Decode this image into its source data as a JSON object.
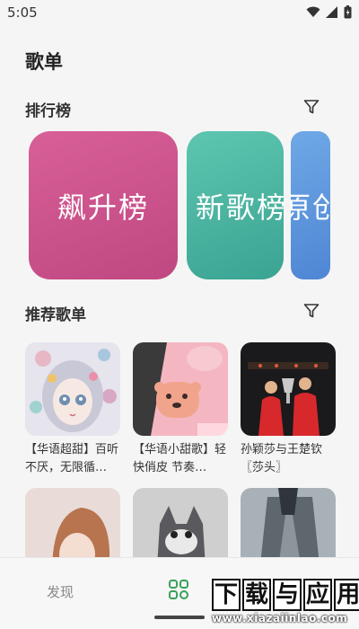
{
  "status_bar": {
    "time": "5:05"
  },
  "page": {
    "title": "歌单"
  },
  "ranking": {
    "title": "排行榜",
    "cards": [
      {
        "label": "飙升榜",
        "color_from": "#d85f98",
        "color_to": "#c04880"
      },
      {
        "label": "新歌榜",
        "color_from": "#5ec6b0",
        "color_to": "#3aa392"
      },
      {
        "label": "原创",
        "color_from": "#6fa8e6",
        "color_to": "#4f86d4"
      }
    ]
  },
  "recommend": {
    "title": "推荐歌单",
    "playlists": [
      {
        "title": "【华语超甜】百听不厌，无限循…"
      },
      {
        "title": "【华语小甜歌】轻快俏皮 节奏…"
      },
      {
        "title": "孙颖莎与王楚钦〖莎头〗"
      },
      {
        "title": ""
      },
      {
        "title": ""
      },
      {
        "title": ""
      }
    ]
  },
  "tab_bar": {
    "discover_label": "发现",
    "accent_color": "#3aa05a"
  },
  "watermark": {
    "main": [
      "下",
      "载",
      "与",
      "应",
      "用"
    ],
    "url": "www.xiazaiinlao.com"
  },
  "icons": [
    "wifi-icon",
    "signal-icon",
    "battery-icon",
    "filter-icon",
    "grid-icon"
  ]
}
